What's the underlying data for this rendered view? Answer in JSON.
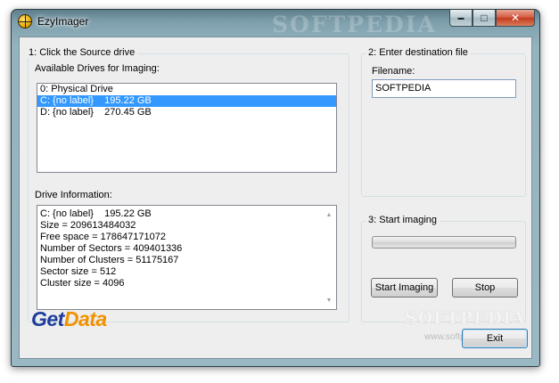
{
  "window": {
    "title": "EzyImager",
    "title_watermark": "SOFTPEDIA",
    "caption_buttons": {
      "minimize": "▬",
      "maximize": "□",
      "close": "✕"
    }
  },
  "source": {
    "group_title": "1:  Click the Source drive",
    "drives_label": "Available Drives for Imaging:",
    "drives": [
      "0: Physical Drive",
      "C: {no label}    195.22 GB",
      "D: {no label}    270.45 GB"
    ],
    "selected_index": 1,
    "info_label": "Drive Information:",
    "info_lines": [
      "C: {no label}    195.22 GB",
      "Size = 209613484032",
      "Free space = 178647171072",
      "Number of Sectors = 409401336",
      "Number of Clusters = 51175167",
      "Sector size = 512",
      "Cluster size = 4096"
    ],
    "scroll_up_icon": "▲",
    "scroll_down_icon": "▼"
  },
  "destination": {
    "group_title": "2: Enter destination file",
    "filename_label": "Filename:",
    "filename_value": "SOFTPEDIA"
  },
  "imaging": {
    "group_title": "3: Start imaging",
    "progress": 0,
    "start_label": "Start Imaging",
    "stop_label": "Stop"
  },
  "footer": {
    "logo_get": "Get",
    "logo_data": "Data",
    "watermark": "SOFTPEDIA",
    "watermark_url": "www.softpedia.com",
    "exit_label": "Exit"
  },
  "colors": {
    "selection": "#3399ff",
    "logo_blue": "#1e3c9c",
    "logo_orange": "#f29100"
  }
}
